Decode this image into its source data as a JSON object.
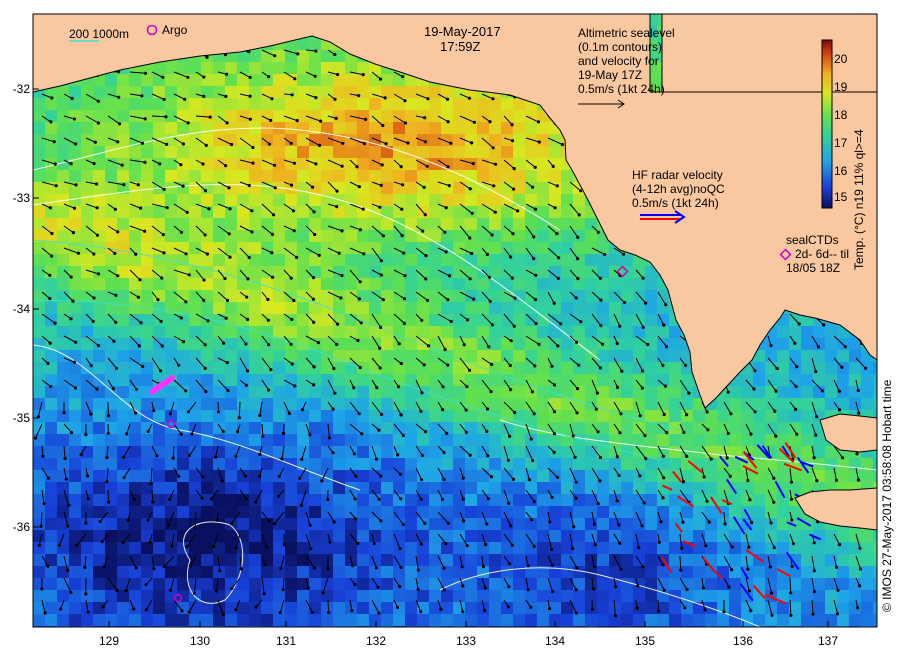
{
  "header": {
    "date": "19-May-2017",
    "time": "17:59Z"
  },
  "legend": {
    "bathymetry_label": "200  1000m",
    "argo_label": "Argo",
    "altimetry_lines": [
      "Altimetric sealevel",
      "(0.1m contours)",
      "and velocity for",
      "19-May 17Z",
      "0.5m/s (1kt 24h)"
    ],
    "hf_radar_lines": [
      "HF radar velocity",
      "(4-12h avg)noQC",
      "0.5m/s (1kt 24h)"
    ],
    "sealctd_lines": [
      "sealCTDs",
      "2d- 6d-- til",
      "18/05 18Z"
    ]
  },
  "colorbar": {
    "title": "Temp. (°C) n19 11% ql>=4",
    "ticks": [
      "20",
      "19",
      "18",
      "17",
      "16",
      "15"
    ],
    "min": 14.6,
    "max": 20.6
  },
  "axes": {
    "y_ticks": [
      "-32",
      "-33",
      "-34",
      "-35",
      "-36"
    ],
    "x_ticks": [
      "129",
      "130",
      "131",
      "132",
      "133",
      "134",
      "135",
      "136",
      "137"
    ]
  },
  "copyright": "© IMOS 27-May-2017 03:58:08 Hobart time",
  "colors": {
    "land": "#f9c8a0",
    "coast": "#000000",
    "argo": "#cc00cc",
    "hf_radar_arrow": "#0000ff",
    "hf_radar_arrow2": "#ff0000",
    "bathymetry": "#40e0d0",
    "sealevel_contour": "#ffffff"
  }
}
